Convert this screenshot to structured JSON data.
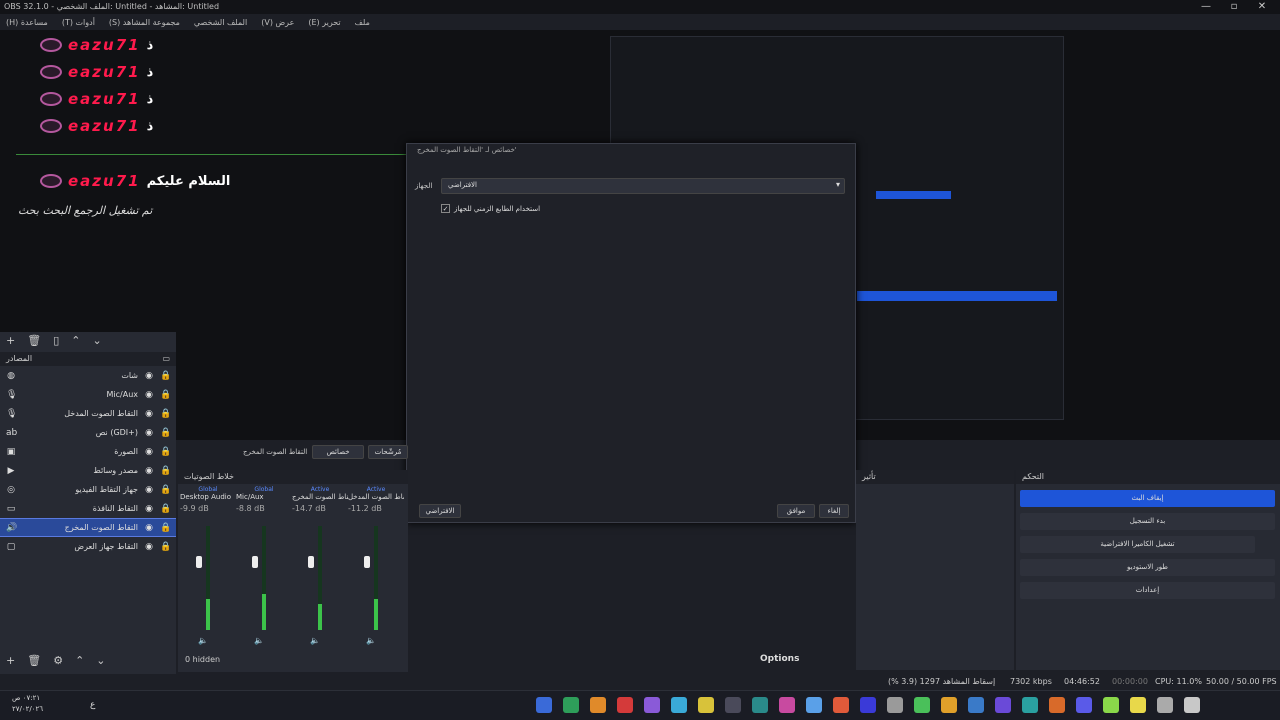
{
  "window": {
    "title": "OBS 32.1.0 - الملف الشخصي: Untitled - المشاهد: Untitled",
    "minimize": "—",
    "maximize": "▫",
    "close": "✕"
  },
  "menu": [
    "(H) مساعدة",
    "(T) أدوات",
    "(S) مجموعة المشاهد",
    "الملف الشخصي",
    "(V) عرض",
    "(E) تحرير",
    "ملف"
  ],
  "chat": {
    "username": "eazu71",
    "suffix": "ذ",
    "greeting": "السلام عليكم",
    "notice": "تم تشغيل الرجمع البحث بحث",
    "rows": [
      "ذ",
      "ذ",
      "ذ",
      "ذ"
    ]
  },
  "dialog": {
    "title": "خصائص لـ 'التقاط الصوت المخرج'",
    "device_label": "الجهاز",
    "device_value": "الافتراضي",
    "checkbox_label": "استخدام الطابع الزمني للجهاز",
    "defaults_button": "الافتراضي",
    "ok_button": "موافق",
    "cancel_button": "إلغاء"
  },
  "sources": {
    "header": "المصادر",
    "items": [
      {
        "label": "شات",
        "icon": "globe-icon"
      },
      {
        "label": "Mic/Aux",
        "icon": "mic-icon"
      },
      {
        "label": "التقاط الصوت المدخل",
        "icon": "mic-icon"
      },
      {
        "label": "نص (GDI+)",
        "icon": "text-icon"
      },
      {
        "label": "الصورة",
        "icon": "image-icon"
      },
      {
        "label": "مصدر وسائط",
        "icon": "play-icon"
      },
      {
        "label": "جهاز التقاط الفيديو",
        "icon": "camera-icon"
      },
      {
        "label": "التقاط النافذة",
        "icon": "window-icon"
      },
      {
        "label": "التقاط الصوت المخرج",
        "icon": "speaker-icon"
      },
      {
        "label": "التقاط جهاز العرض",
        "icon": "monitor-icon"
      }
    ],
    "hidden_count": "0 hidden"
  },
  "scene_tab": {
    "properties": "خصائص",
    "filters": "مُرشّحات",
    "selected": "التقاط الصوت المخرج"
  },
  "mixer": {
    "header": "خلاط الصوتيات",
    "channels": [
      {
        "tag": "Global",
        "name": "Desktop Audio",
        "db": "-9.9 dB",
        "level": 0.3
      },
      {
        "tag": "Global",
        "name": "Mic/Aux",
        "db": "-8.8 dB",
        "level": 0.35
      },
      {
        "tag": "Active",
        "name": "التقاط الصوت المخرج",
        "db": "-14.7 dB",
        "level": 0.25
      },
      {
        "tag": "Active",
        "name": "التقاط الصوت المدخل",
        "db": "-11.2 dB",
        "level": 0.3
      }
    ],
    "scale": [
      "0",
      "-6",
      "-12",
      "-18",
      "-24",
      "-30",
      "-36",
      "-42",
      "-48",
      "-54",
      "-60"
    ],
    "options": "Options"
  },
  "transitions": {
    "header": "تأثير"
  },
  "controls": {
    "header": "التحكم",
    "buttons": [
      "إيقاف البث",
      "بدء التسجيل",
      "تشغيل الكاميرا الافتراضية",
      "طور الاستوديو",
      "إعدادات"
    ]
  },
  "status": {
    "dropped": "إسقاط المشاهد 1297 (3.9 %)",
    "bitrate": "7302 kbps",
    "stream_time": "04:46:52",
    "rec_time": "00:00:00",
    "cpu": "CPU: 11.0%",
    "fps": "50.00 / 50.00 FPS"
  },
  "taskbar": {
    "time": "٠٧:٢١ ص",
    "date": "٢٧/٠٢/٠٢٦",
    "lang": "ع"
  },
  "colors": {
    "accent": "#2a4a9a",
    "live": "#1e55d8",
    "chat_name": "#ff1a4c"
  }
}
